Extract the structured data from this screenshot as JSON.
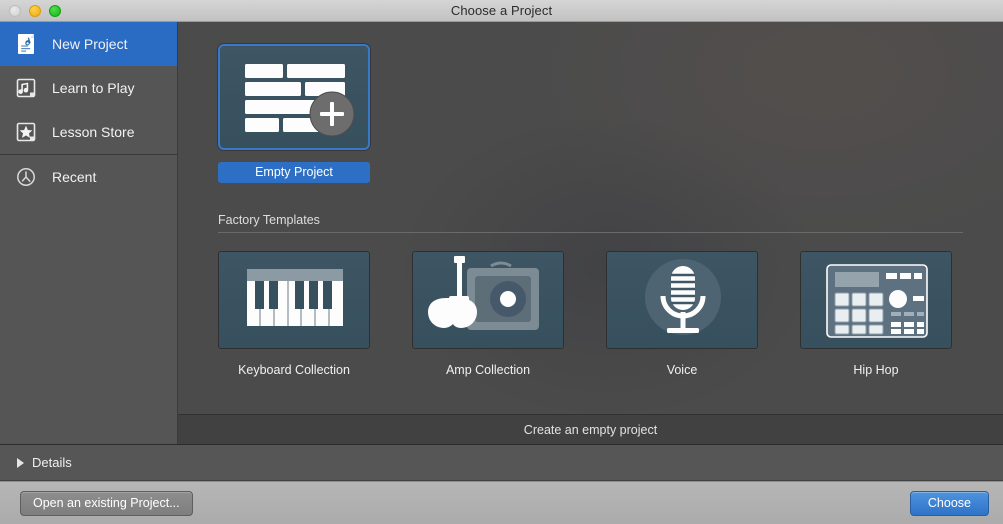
{
  "window": {
    "title": "Choose a Project",
    "traffic_lights": [
      {
        "name": "close-button",
        "color": "#d8d8d8",
        "enabled": false
      },
      {
        "name": "minimize-button",
        "color": "#edab14",
        "enabled": true
      },
      {
        "name": "maximize-button",
        "color": "#14b814",
        "enabled": true
      }
    ]
  },
  "sidebar": {
    "items": [
      {
        "label": "New Project",
        "icon": "guitar-document-icon",
        "selected": true
      },
      {
        "label": "Learn to Play",
        "icon": "music-note-icon",
        "selected": false
      },
      {
        "label": "Lesson Store",
        "icon": "star-icon",
        "selected": false
      },
      {
        "label": "Recent",
        "icon": "clock-icon",
        "selected": false
      }
    ],
    "selected_bg": "#2a6bc4"
  },
  "main": {
    "empty_project": {
      "label": "Empty Project",
      "icon": "regions-plus-icon",
      "selected": true,
      "highlight_color": "#2e6fc6",
      "border_color": "#3a78c9"
    },
    "factory_templates": {
      "heading": "Factory Templates",
      "cards": [
        {
          "label": "Keyboard Collection",
          "icon": "piano-keyboard-icon"
        },
        {
          "label": "Amp Collection",
          "icon": "guitar-amp-icon"
        },
        {
          "label": "Voice",
          "icon": "microphone-icon"
        },
        {
          "label": "Hip Hop",
          "icon": "drum-machine-icon"
        }
      ]
    },
    "status": "Create an empty project"
  },
  "details": {
    "label": "Details",
    "disclosure_icon": "triangle-right-icon",
    "expanded": false
  },
  "footer": {
    "open_existing_label": "Open an existing Project...",
    "choose_label": "Choose",
    "accent_color": "#2f73c8"
  }
}
